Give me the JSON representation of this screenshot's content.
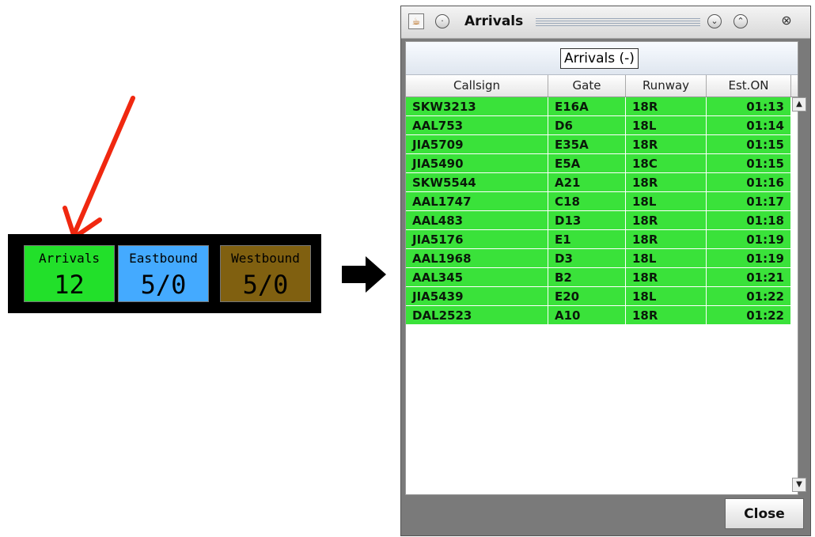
{
  "status_panel": {
    "arrivals": {
      "label": "Arrivals",
      "value": "12",
      "color": "#22e02a"
    },
    "eastbound": {
      "label": "Eastbound",
      "value": "5/0",
      "color": "#44aaff"
    },
    "westbound": {
      "label": "Westbound",
      "value": "5/0",
      "color": "#806010"
    }
  },
  "window": {
    "title": "Arrivals",
    "icons": {
      "app": "java-icon",
      "menu": "circle-menu-icon",
      "minimize": "chevron-down-icon",
      "maximize": "chevron-up-icon",
      "close": "close-icon"
    },
    "table_title": "Arrivals (-)",
    "columns": [
      "Callsign",
      "Gate",
      "Runway",
      "Est.ON"
    ],
    "row_color": "#3ae23a",
    "rows": [
      [
        "SKW3213",
        "E16A",
        "18R",
        "01:13"
      ],
      [
        "AAL753",
        "D6",
        "18L",
        "01:14"
      ],
      [
        "JIA5709",
        "E35A",
        "18R",
        "01:15"
      ],
      [
        "JIA5490",
        "E5A",
        "18C",
        "01:15"
      ],
      [
        "SKW5544",
        "A21",
        "18R",
        "01:16"
      ],
      [
        "AAL1747",
        "C18",
        "18L",
        "01:17"
      ],
      [
        "AAL483",
        "D13",
        "18R",
        "01:18"
      ],
      [
        "JIA5176",
        "E1",
        "18R",
        "01:19"
      ],
      [
        "AAL1968",
        "D3",
        "18L",
        "01:19"
      ],
      [
        "AAL345",
        "B2",
        "18R",
        "01:21"
      ],
      [
        "JIA5439",
        "E20",
        "18L",
        "01:22"
      ],
      [
        "DAL2523",
        "A10",
        "18R",
        "01:22"
      ]
    ],
    "close_label": "Close"
  }
}
